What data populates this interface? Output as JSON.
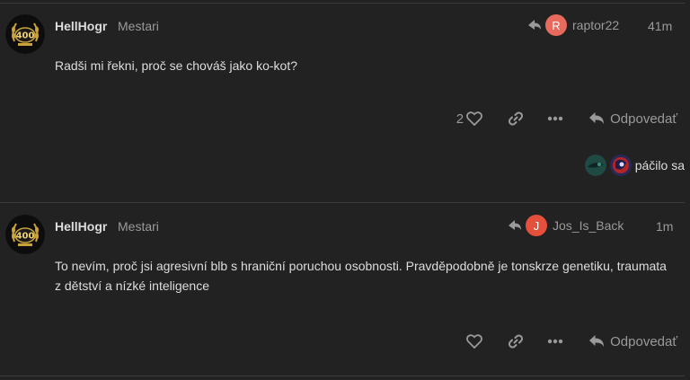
{
  "posts": [
    {
      "username": "HellHogr",
      "user_title": "Mestari",
      "avatar_badge": "400",
      "reply_to": {
        "initial": "R",
        "name": "raptor22",
        "color": "#e86a5c"
      },
      "time": "41m",
      "body": "Radši mi řekni, proč se chováš jako ko-kot?",
      "like_count": "2",
      "reply_label": "Odpovedať",
      "liked_by_label": "páčilo sa"
    },
    {
      "username": "HellHogr",
      "user_title": "Mestari",
      "avatar_badge": "400",
      "reply_to": {
        "initial": "J",
        "name": "Jos_Is_Back",
        "color": "#e5503d"
      },
      "time": "1m",
      "body": "To nevím, proč jsi agresivní blb s hraniční poruchou osobnosti. Pravděpodobně je tonskrze genetiku, traumata z dětství a nízké inteligence",
      "like_count": "",
      "reply_label": "Odpovedať"
    }
  ],
  "colors": {
    "background": "#222222",
    "muted": "#9a9a9a",
    "text": "#dddddd"
  },
  "icons": [
    "reply-arrow-icon",
    "heart-icon",
    "link-icon",
    "more-icon",
    "reply-icon"
  ]
}
